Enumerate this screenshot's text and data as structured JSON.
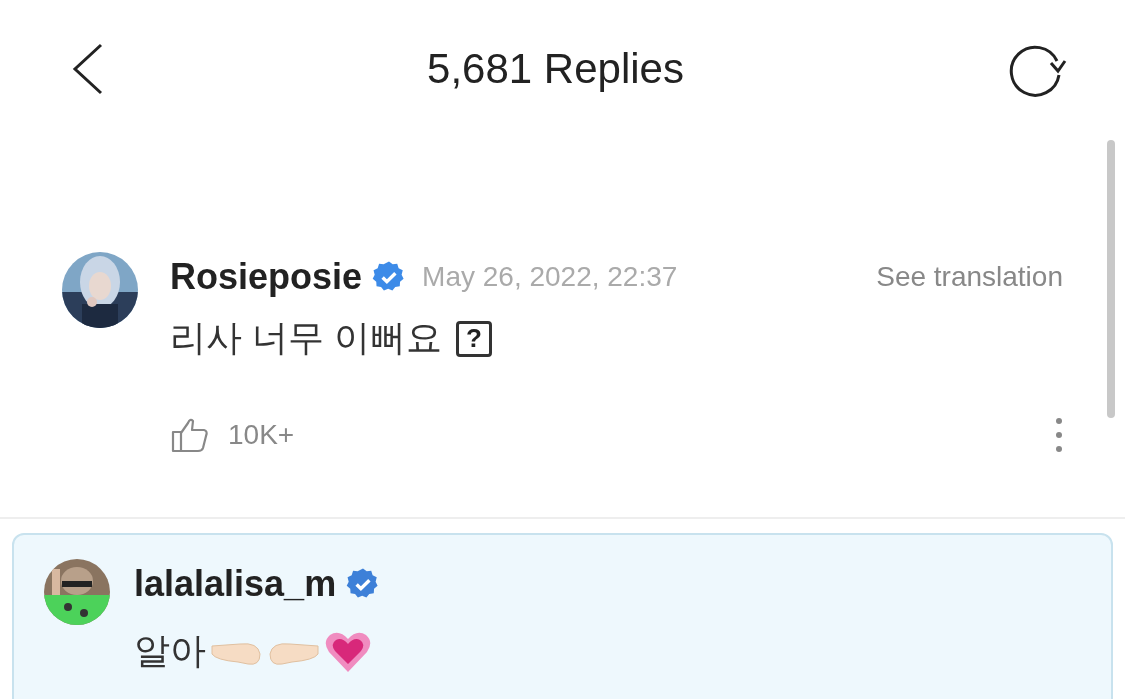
{
  "header": {
    "title": "5,681 Replies"
  },
  "comment": {
    "author": "Rosieposie",
    "verified": true,
    "time": "May 26, 2022, 22:37",
    "translate": "See translation",
    "text": "리사 너무 이뻐요",
    "glyph": "?",
    "likes": "10K+"
  },
  "reply": {
    "author": "lalalalisa_m",
    "verified": true,
    "text": "알아"
  }
}
